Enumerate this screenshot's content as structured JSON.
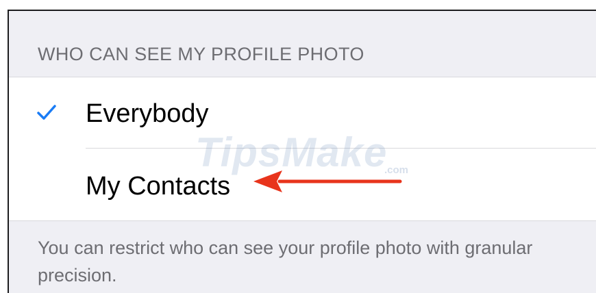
{
  "section": {
    "header": "WHO CAN SEE MY PROFILE PHOTO",
    "options": [
      {
        "label": "Everybody",
        "selected": true
      },
      {
        "label": "My Contacts",
        "selected": false
      }
    ],
    "footer": "You can restrict who can see your profile photo with granular precision."
  },
  "annotation": {
    "arrow_color": "#e8341c",
    "arrow_target": "My Contacts"
  },
  "watermark": {
    "text": "TipsMake",
    "suffix": ".com"
  },
  "colors": {
    "accent": "#1a7cf5",
    "background": "#efeff4",
    "secondary_text": "#6d6d72"
  },
  "icons": {
    "checkmark": "checkmark-icon",
    "arrow": "arrow-left-icon"
  }
}
